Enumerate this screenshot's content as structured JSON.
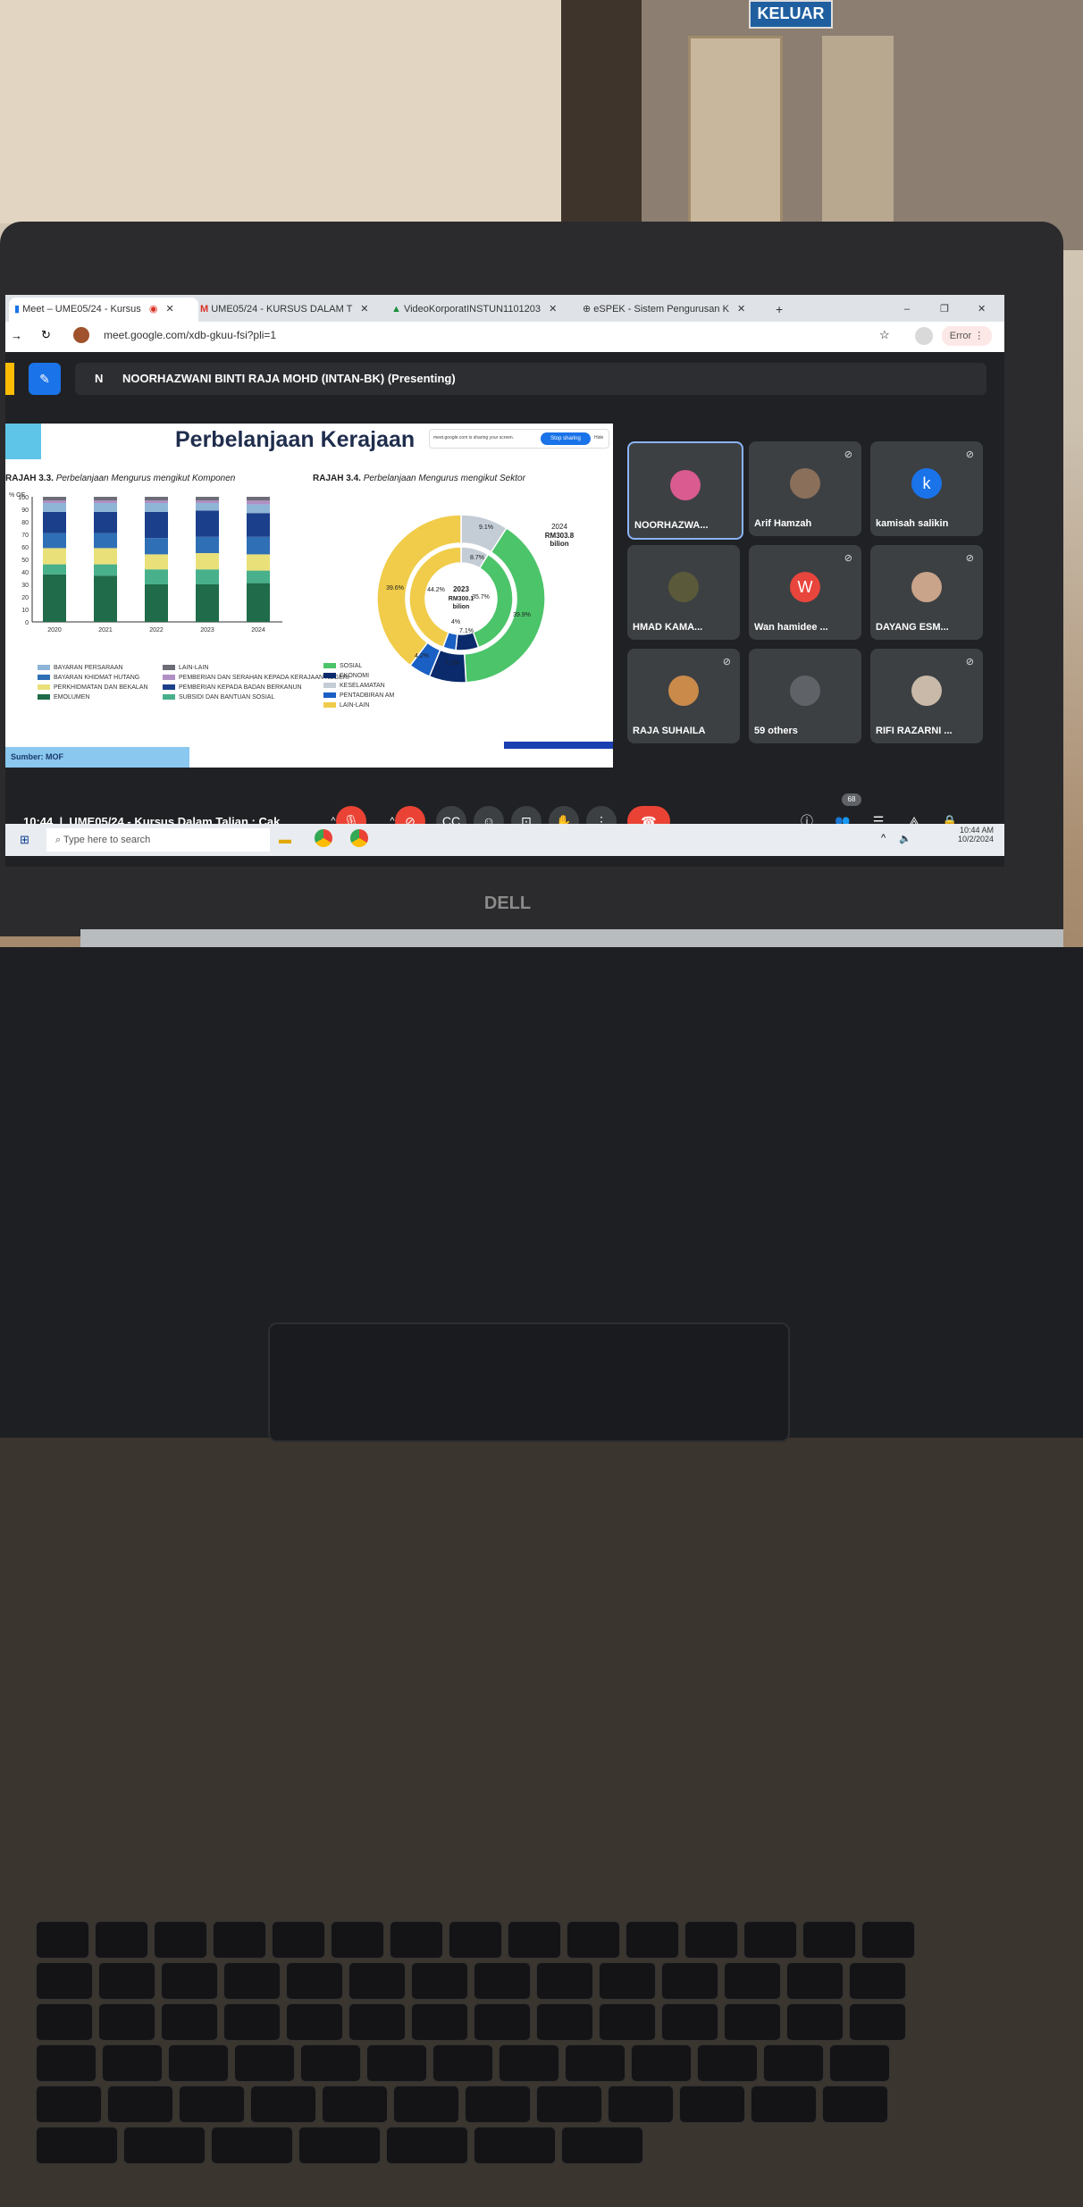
{
  "room": {
    "exit_sign": "KELUAR"
  },
  "browser": {
    "tabs": [
      {
        "label": "Meet – UME05/24 - Kursus"
      },
      {
        "label": "UME05/24 - KURSUS DALAM T"
      },
      {
        "label": "VideoKorporatINSTUN1101203"
      },
      {
        "label": "eSPEK - Sistem Pengurusan K"
      }
    ],
    "url": "meet.google.com/xdb-gkuu-fsi?pli=1",
    "error_label": "Error"
  },
  "meet": {
    "presenter_initial": "N",
    "presenter_text": "NOORHAZWANI BINTI RAJA MOHD (INTAN-BK) (Presenting)",
    "sharing_notice": "meet.google.com is sharing your screen.",
    "stop_sharing": "Stop sharing",
    "hide": "Hide",
    "time": "10:44",
    "meeting_title": "UME05/24 - Kursus Dalam Talian : Cak...",
    "participant_count": "68",
    "participants": [
      {
        "name": "NOORHAZWA...",
        "initial": ""
      },
      {
        "name": "Arif Hamzah",
        "initial": ""
      },
      {
        "name": "kamisah salikin",
        "initial": "k"
      },
      {
        "name": "HMAD KAMA...",
        "initial": ""
      },
      {
        "name": "Wan hamidee ...",
        "initial": "W"
      },
      {
        "name": "DAYANG ESM...",
        "initial": ""
      },
      {
        "name": "RAJA SUHAILA",
        "initial": ""
      },
      {
        "name": "59 others",
        "initial": ""
      },
      {
        "name": "RIFI RAZARNI ...",
        "initial": ""
      }
    ]
  },
  "slide": {
    "title": "Perbelanjaan Kerajaan",
    "left_caption_bold": "RAJAH 3.3.",
    "left_caption": "Perbelanjaan Mengurus mengikut Komponen",
    "right_caption_bold": "RAJAH 3.4.",
    "right_caption": "Perbelanjaan Mengurus mengikut Sektor",
    "y_unit": "% OE",
    "source": "Sumber: MOF",
    "donut_center_year": "2023",
    "donut_center_value": "RM300.1",
    "donut_center_unit": "bilion",
    "outer_label_year": "2024",
    "outer_label_value": "RM303.8",
    "outer_label_unit": "bilion",
    "left_legend": [
      {
        "label": "BAYARAN PERSARAAN",
        "color": "#8fb5d6"
      },
      {
        "label": "BAYARAN KHIDMAT HUTANG",
        "color": "#2f6fb5"
      },
      {
        "label": "PERKHIDMATAN DAN BEKALAN",
        "color": "#e9e07a"
      },
      {
        "label": "EMOLUMEN",
        "color": "#1f6b4a"
      },
      {
        "label": "LAIN-LAIN",
        "color": "#6d6d78"
      },
      {
        "label": "PEMBERIAN DAN SERAHAN KEPADA KERAJAAN NEGERI",
        "color": "#b08fc4"
      },
      {
        "label": "PEMBERIAN KEPADA BADAN BERKANUN",
        "color": "#1b3f8a"
      },
      {
        "label": "SUBSIDI DAN BANTUAN SOSIAL",
        "color": "#48b08a"
      }
    ],
    "right_legend": [
      {
        "label": "SOSIAL",
        "color": "#4cc46a"
      },
      {
        "label": "EKONOMI",
        "color": "#0a2a6b"
      },
      {
        "label": "KESELAMATAN",
        "color": "#c4ccd6"
      },
      {
        "label": "PENTADBIRAN AM",
        "color": "#1a5fc4"
      },
      {
        "label": "LAIN-LAIN",
        "color": "#f0cc4a"
      }
    ]
  },
  "taskbar": {
    "search_placeholder": "Type here to search",
    "clock_time": "10:44 AM",
    "clock_date": "10/2/2024"
  },
  "laptop": {
    "brand": "DELL"
  },
  "chart_data": [
    {
      "type": "bar",
      "title": "Perbelanjaan Mengurus mengikut Komponen",
      "ylabel": "% OE",
      "ylim": [
        0,
        100
      ],
      "categories": [
        "2020",
        "2021",
        "2022",
        "2023",
        "2024"
      ],
      "series": [
        {
          "name": "EMOLUMEN",
          "values": [
            38,
            37,
            30,
            30,
            31
          ]
        },
        {
          "name": "SUBSIDI DAN BANTUAN SOSIAL",
          "values": [
            8,
            9,
            12,
            12,
            10
          ]
        },
        {
          "name": "PERKHIDMATAN DAN BEKALAN",
          "values": [
            13,
            13,
            12,
            13,
            13
          ]
        },
        {
          "name": "BAYARAN KHIDMAT HUTANG",
          "values": [
            12,
            12,
            13,
            13,
            14
          ]
        },
        {
          "name": "PEMBERIAN KEPADA BADAN BERKANUN",
          "values": [
            17,
            17,
            21,
            21,
            19
          ]
        },
        {
          "name": "BAYARAN PERSARAAN",
          "values": [
            7,
            7,
            7,
            6,
            7
          ]
        },
        {
          "name": "PEMBERIAN DAN SERAHAN KEPADA KERAJAAN NEGERI",
          "values": [
            2,
            2,
            2,
            2,
            3
          ]
        },
        {
          "name": "LAIN-LAIN",
          "values": [
            3,
            3,
            3,
            3,
            3
          ]
        }
      ]
    },
    {
      "type": "pie",
      "title": "Perbelanjaan Mengurus mengikut Sektor",
      "series": [
        {
          "name": "2024",
          "labels": [
            "SOSIAL",
            "EKONOMI",
            "PENTADBIRAN AM",
            "LAIN-LAIN",
            "KESELAMATAN"
          ],
          "values": [
            39.9,
            7.1,
            4.2,
            39.6,
            9.1
          ]
        },
        {
          "name": "2023",
          "labels": [
            "SOSIAL",
            "EKONOMI",
            "PENTADBIRAN AM",
            "LAIN-LAIN",
            "KESELAMATAN"
          ],
          "values": [
            35.7,
            7.1,
            4.0,
            44.2,
            8.7
          ]
        }
      ],
      "labels_text": [
        "9.1%",
        "39.6%",
        "39.9%",
        "7.1%",
        "4.2%",
        "8.7%",
        "44.2%",
        "35.7%",
        "7.1%",
        "4%"
      ]
    }
  ]
}
